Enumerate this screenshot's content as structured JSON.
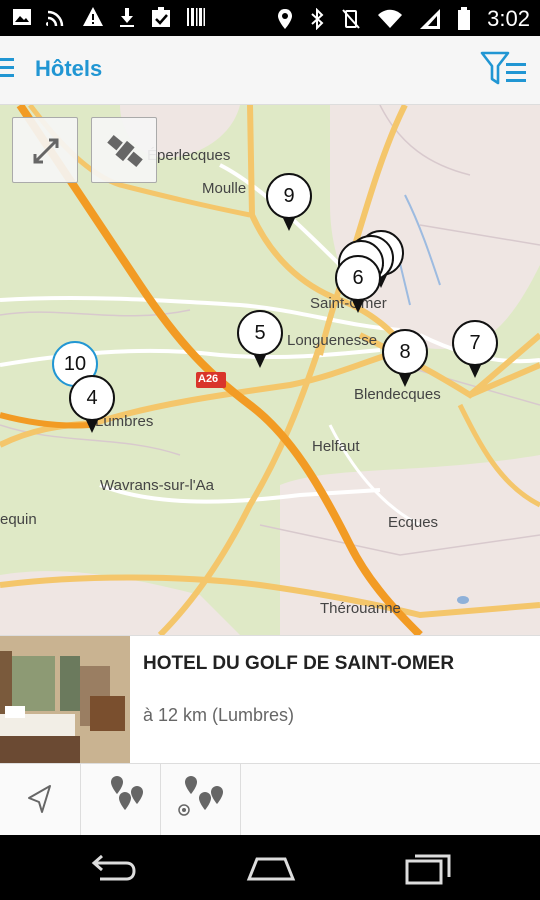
{
  "status_bar": {
    "time": "3:02",
    "left_icons": [
      "image-icon",
      "cast-icon",
      "warning-icon",
      "download-icon",
      "clipboard-check-icon",
      "barcode-icon"
    ],
    "right_icons": [
      "location-icon",
      "bluetooth-icon",
      "vibrate-off-icon",
      "wifi-icon",
      "signal-icon",
      "battery-icon"
    ]
  },
  "app_bar": {
    "title": "Hôtels",
    "accent_color": "#2196d3"
  },
  "map": {
    "labels": [
      {
        "id": "eperlecques",
        "text": "Éperlecques"
      },
      {
        "id": "moulle",
        "text": "Moulle"
      },
      {
        "id": "saint-omer",
        "text": "Saint-Omer"
      },
      {
        "id": "longuenesse",
        "text": "Longuenesse"
      },
      {
        "id": "blendecques",
        "text": "Blendecques"
      },
      {
        "id": "lumbres",
        "text": "Lumbres"
      },
      {
        "id": "helfaut",
        "text": "Helfaut"
      },
      {
        "id": "wavrans",
        "text": "Wavrans-sur-l'Aa"
      },
      {
        "id": "ecques",
        "text": "Ecques"
      },
      {
        "id": "therouanne",
        "text": "Thérouanne"
      },
      {
        "id": "equin",
        "text": "equin"
      },
      {
        "id": "a26",
        "text": "A26"
      }
    ],
    "pins": [
      {
        "id": "pin-9",
        "label": "9"
      },
      {
        "id": "pin-6",
        "label": "6"
      },
      {
        "id": "pin-5",
        "label": "5"
      },
      {
        "id": "pin-8",
        "label": "8"
      },
      {
        "id": "pin-7",
        "label": "7"
      },
      {
        "id": "pin-10",
        "label": "10"
      },
      {
        "id": "pin-4",
        "label": "4"
      }
    ]
  },
  "hotel_card": {
    "name": "HOTEL DU GOLF DE SAINT-OMER",
    "distance": "à 12 km (Lumbres)"
  },
  "toolbar": {
    "buttons": [
      "navigate-icon",
      "all-pins-icon",
      "nearby-pins-icon"
    ]
  }
}
